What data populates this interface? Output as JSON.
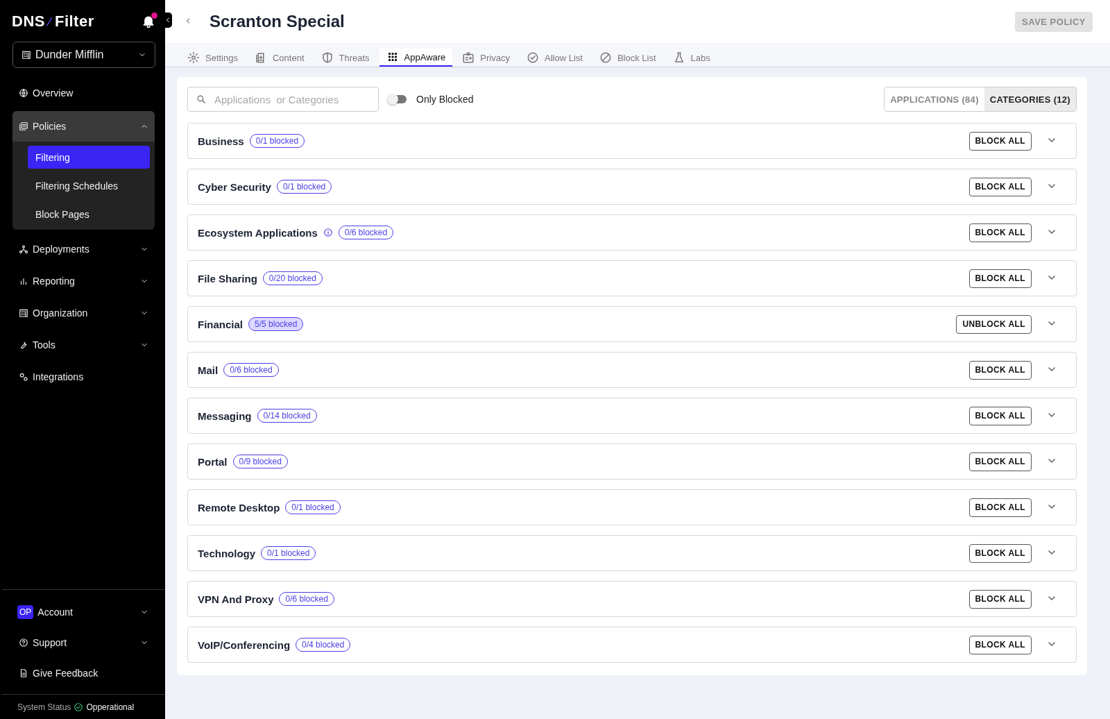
{
  "sidebar": {
    "logo": {
      "left": "DNS",
      "right": "Filter"
    },
    "notifications": {
      "unread": true
    },
    "organization": {
      "label": "Dunder Mifflin"
    },
    "items": [
      {
        "label": "Overview",
        "kind": "link"
      },
      {
        "label": "Policies",
        "kind": "group",
        "expanded": true,
        "children": [
          {
            "label": "Filtering",
            "selected": true
          },
          {
            "label": "Filtering Schedules",
            "selected": false
          },
          {
            "label": "Block Pages",
            "selected": false
          }
        ]
      },
      {
        "label": "Deployments",
        "kind": "group",
        "expanded": false
      },
      {
        "label": "Reporting",
        "kind": "group",
        "expanded": false
      },
      {
        "label": "Organization",
        "kind": "group",
        "expanded": false
      },
      {
        "label": "Tools",
        "kind": "group",
        "expanded": false
      },
      {
        "label": "Integrations",
        "kind": "link"
      }
    ],
    "bottom_items": [
      {
        "label": "Account",
        "kind": "group",
        "avatar": "OP"
      },
      {
        "label": "Support",
        "kind": "group"
      },
      {
        "label": "Give Feedback",
        "kind": "link"
      }
    ],
    "status": {
      "label": "System Status",
      "value": "Opperational"
    }
  },
  "header": {
    "title": "Scranton Special",
    "save_button": {
      "label": "SAVE POLICY",
      "disabled": true
    }
  },
  "tabs": [
    {
      "label": "Settings",
      "selected": false
    },
    {
      "label": "Content",
      "selected": false
    },
    {
      "label": "Threats",
      "selected": false
    },
    {
      "label": "AppAware",
      "selected": true
    },
    {
      "label": "Privacy",
      "selected": false
    },
    {
      "label": "Allow List",
      "selected": false
    },
    {
      "label": "Block List",
      "selected": false
    },
    {
      "label": "Labs",
      "selected": false
    }
  ],
  "search": {
    "placeholder": "Applications  or Categories"
  },
  "only_blocked": {
    "label": "Only Blocked",
    "on": false
  },
  "view_switch": [
    {
      "label": "APPLICATIONS (84)",
      "selected": false
    },
    {
      "label": "CATEGORIES (12)",
      "selected": true
    }
  ],
  "categories": [
    {
      "name": "Business",
      "info": false,
      "count": "0/1 blocked",
      "all_blocked": false,
      "action": "BLOCK ALL"
    },
    {
      "name": "Cyber Security",
      "info": false,
      "count": "0/1 blocked",
      "all_blocked": false,
      "action": "BLOCK ALL"
    },
    {
      "name": "Ecosystem Applications",
      "info": true,
      "count": "0/6 blocked",
      "all_blocked": false,
      "action": "BLOCK ALL"
    },
    {
      "name": "File Sharing",
      "info": false,
      "count": "0/20 blocked",
      "all_blocked": false,
      "action": "BLOCK ALL"
    },
    {
      "name": "Financial",
      "info": false,
      "count": "5/5 blocked",
      "all_blocked": true,
      "action": "UNBLOCK ALL"
    },
    {
      "name": "Mail",
      "info": false,
      "count": "0/6 blocked",
      "all_blocked": false,
      "action": "BLOCK ALL"
    },
    {
      "name": "Messaging",
      "info": false,
      "count": "0/14 blocked",
      "all_blocked": false,
      "action": "BLOCK ALL"
    },
    {
      "name": "Portal",
      "info": false,
      "count": "0/9 blocked",
      "all_blocked": false,
      "action": "BLOCK ALL"
    },
    {
      "name": "Remote Desktop",
      "info": false,
      "count": "0/1 blocked",
      "all_blocked": false,
      "action": "BLOCK ALL"
    },
    {
      "name": "Technology",
      "info": false,
      "count": "0/1 blocked",
      "all_blocked": false,
      "action": "BLOCK ALL"
    },
    {
      "name": "VPN And Proxy",
      "info": false,
      "count": "0/6 blocked",
      "all_blocked": false,
      "action": "BLOCK ALL"
    },
    {
      "name": "VoIP/Conferencing",
      "info": false,
      "count": "0/4 blocked",
      "all_blocked": false,
      "action": "BLOCK ALL"
    }
  ]
}
